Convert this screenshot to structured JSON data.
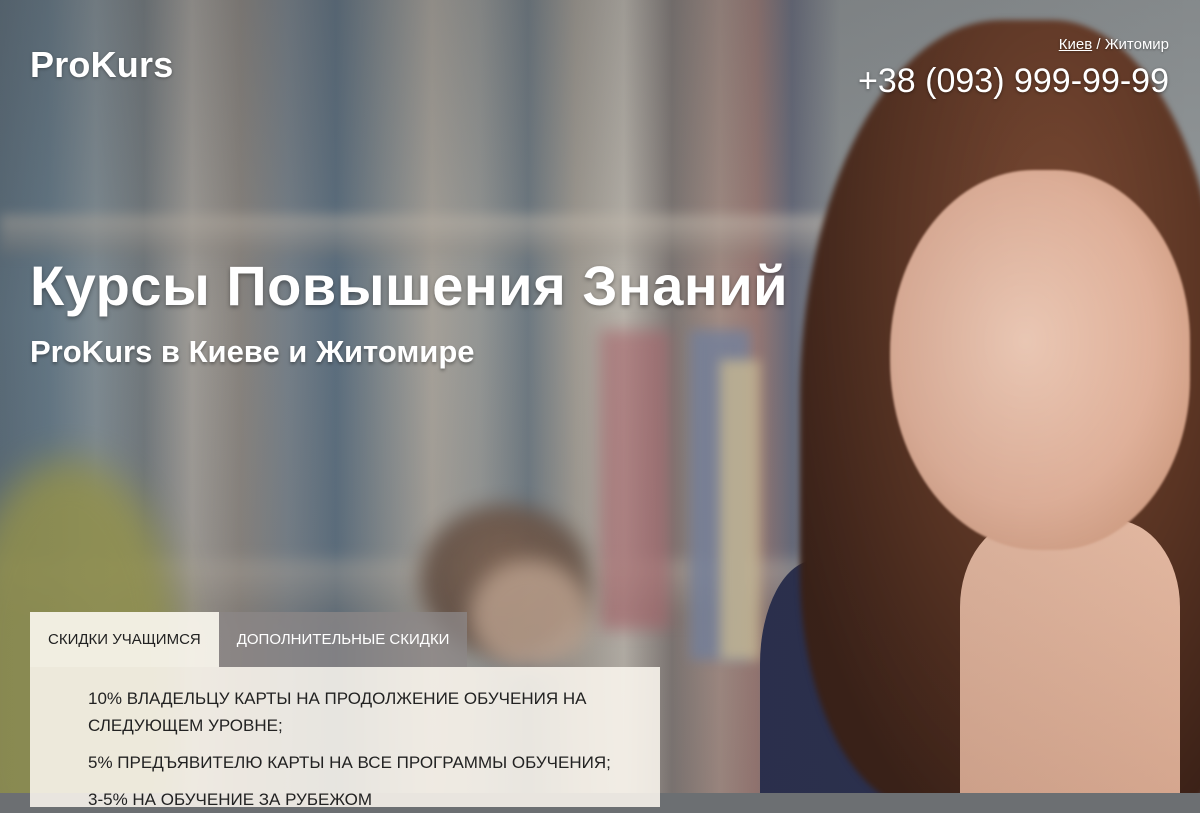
{
  "header": {
    "logo": "ProKurs",
    "city_primary": "Киев",
    "city_separator": " / ",
    "city_secondary": "Житомир",
    "phone": "+38 (093) 999-99-99"
  },
  "hero": {
    "title": "Курсы Повышения Знаний",
    "subtitle": "ProKurs в Киеве и Житомире"
  },
  "tabs": [
    {
      "label": "СКИДКИ УЧАЩИМСЯ",
      "active": true
    },
    {
      "label": "ДОПОЛНИТЕЛЬНЫЕ СКИДКИ",
      "active": false
    }
  ],
  "discounts": [
    "10% ВЛАДЕЛЬЦУ КАРТЫ НА ПРОДОЛЖЕНИЕ ОБУЧЕНИЯ НА СЛЕДУЮЩЕМ УРОВНЕ;",
    "5% ПРЕДЪЯВИТЕЛЮ КАРТЫ НА ВСЕ ПРОГРАММЫ ОБУЧЕНИЯ;",
    "3-5% НА ОБУЧЕНИЕ ЗА РУБЕЖОМ"
  ]
}
